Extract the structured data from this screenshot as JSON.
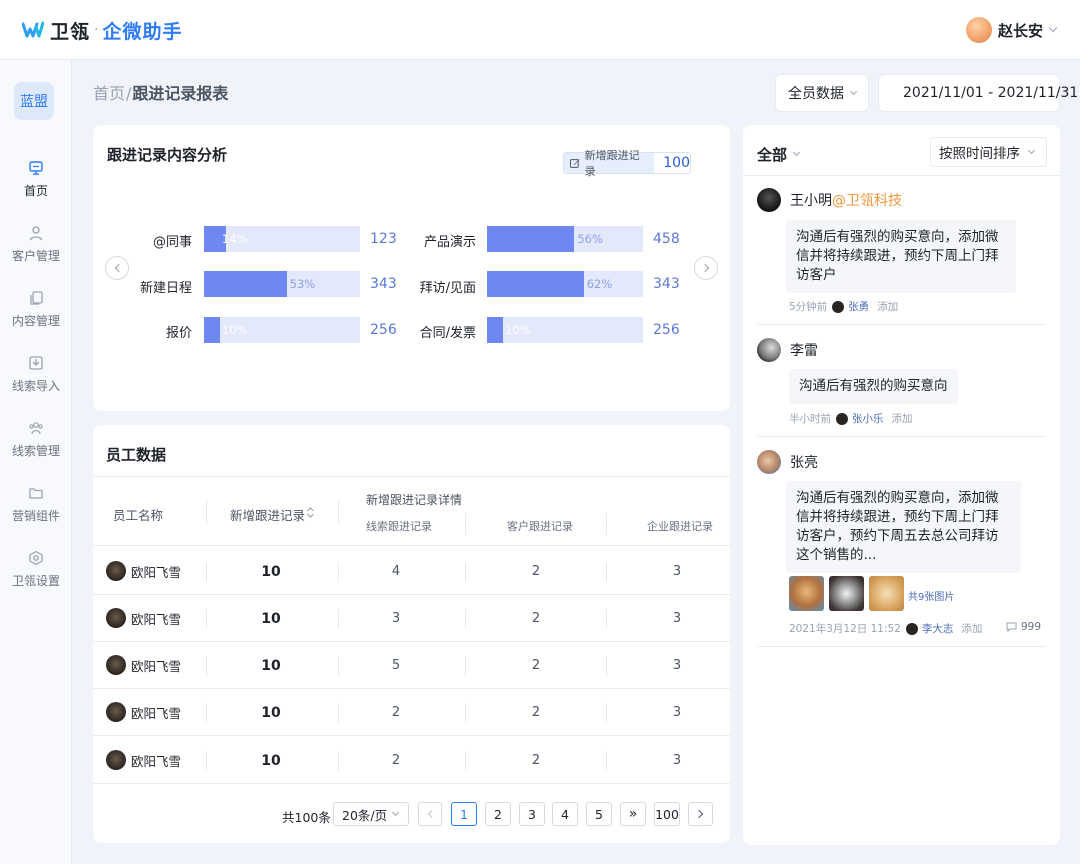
{
  "header": {
    "brand": "卫瓴",
    "brand_sep": "·",
    "product": "企微助手",
    "user_name": "赵长安"
  },
  "sidebar": {
    "workspace": "蓝盟",
    "items": [
      {
        "label": "首页",
        "icon": "monitor-icon",
        "active": true
      },
      {
        "label": "客户管理",
        "icon": "user-icon"
      },
      {
        "label": "内容管理",
        "icon": "copy-icon"
      },
      {
        "label": "线索导入",
        "icon": "inbox-download-icon"
      },
      {
        "label": "线索管理",
        "icon": "users-group-icon"
      },
      {
        "label": "营销组件",
        "icon": "folder-icon"
      },
      {
        "label": "卫瓴设置",
        "icon": "hexagon-settings-icon"
      }
    ]
  },
  "breadcrumb": {
    "home": "首页",
    "sep": "/",
    "current": "跟进记录报表"
  },
  "filters": {
    "scope": "全员数据",
    "date_range": "2021/11/01 - 2021/11/31"
  },
  "analysis": {
    "title": "跟进记录内容分析",
    "badge_label": "新增跟进记录",
    "badge_value": "100",
    "left": [
      {
        "label": "@同事",
        "percent": 14,
        "value": "123"
      },
      {
        "label": "新建日程",
        "percent": 53,
        "value": "343"
      },
      {
        "label": "报价",
        "percent": 10,
        "value": "256"
      }
    ],
    "right": [
      {
        "label": "产品演示",
        "percent": 56,
        "value": "458"
      },
      {
        "label": "拜访/见面",
        "percent": 62,
        "value": "343"
      },
      {
        "label": "合同/发票",
        "percent": 10,
        "value": "256"
      }
    ]
  },
  "employees": {
    "title": "员工数据",
    "headers": {
      "name": "员工名称",
      "new_records": "新增跟进记录",
      "detail": "新增跟进记录详情",
      "lead": "线索跟进记录",
      "customer": "客户跟进记录",
      "company": "企业跟进记录"
    },
    "rows": [
      {
        "name": "欧阳飞雪",
        "new": "10",
        "lead": "4",
        "customer": "2",
        "company": "3"
      },
      {
        "name": "欧阳飞雪",
        "new": "10",
        "lead": "3",
        "customer": "2",
        "company": "3"
      },
      {
        "name": "欧阳飞雪",
        "new": "10",
        "lead": "5",
        "customer": "2",
        "company": "3"
      },
      {
        "name": "欧阳飞雪",
        "new": "10",
        "lead": "2",
        "customer": "2",
        "company": "3"
      },
      {
        "name": "欧阳飞雪",
        "new": "10",
        "lead": "2",
        "customer": "2",
        "company": "3"
      }
    ],
    "pagination": {
      "total": "共100条",
      "page_size": "20条/页",
      "pages": [
        "1",
        "2",
        "3",
        "4",
        "5"
      ],
      "more": "»",
      "last": "100",
      "current": "1"
    }
  },
  "feed": {
    "filter": "全部",
    "sort": "按照时间排序",
    "items": [
      {
        "author": "王小明",
        "mention": "@卫瓴科技",
        "text": "沟通后有强烈的购买意向，添加微信并将持续跟进，预约下周上门拜访客户",
        "time": "5分钟前",
        "by": "张勇",
        "action": "添加"
      },
      {
        "author": "李雷",
        "text": "沟通后有强烈的购买意向",
        "time": "半小时前",
        "by": "张小乐",
        "action": "添加"
      },
      {
        "author": "张亮",
        "text": "沟通后有强烈的购买意向，添加微信并将持续跟进，预约下周上门拜访客户，预约下周五去总公司拜访这个销售的...",
        "more_images": "共9张图片",
        "time": "2021年3月12日 11:52",
        "by": "李大志",
        "action": "添加",
        "comments": "999"
      }
    ]
  },
  "colors": {
    "brand": "#2f7cf6",
    "bar_fill": "#6f87f2",
    "bar_track": "#e3e8fb",
    "mention": "#f0963c"
  }
}
